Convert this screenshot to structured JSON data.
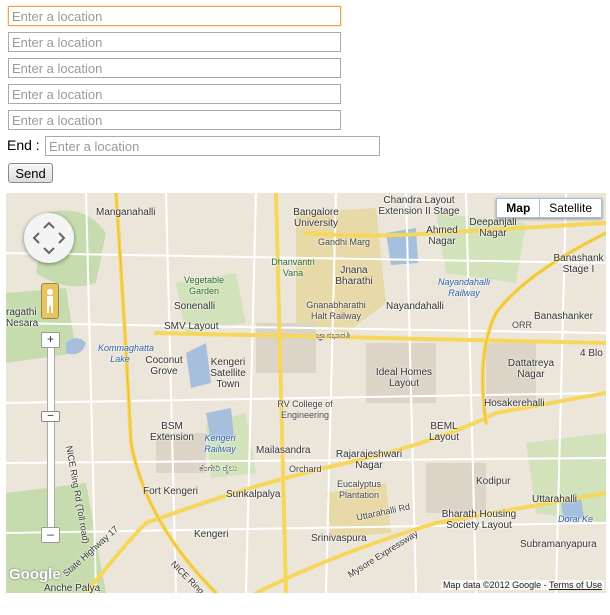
{
  "form": {
    "location_placeholder": "Enter a location",
    "end_label": "End :",
    "send_label": "Send"
  },
  "map": {
    "type_map": "Map",
    "type_satellite": "Satellite",
    "google": "Google",
    "attribution": "Map data ©2012 Google -",
    "terms": "Terms of Use",
    "labels": {
      "manganahalli": "Manganahalli",
      "bangalore_univ": "Bangalore University",
      "chandra_layout": "Chandra Layout Extension II Stage",
      "deepanjali": "Deepanjali Nagar",
      "ahmed": "Ahmed Nagar",
      "banashankari_3": "Banashank Stage I",
      "gandhi_marg": "Gandhi Marg",
      "dhanvantri": "Dhanvantri Vana",
      "jnana": "Jnana Bharathi",
      "nayandahalli_rly": "Nayandahalli Railway",
      "vegetable": "Vegetable Garden",
      "sonenalli": "Sonenalli",
      "gnana_halt": "Gnanabharathi Halt Railway",
      "gnana_kannada": "ಜ್ಞಾನಭಾರತಿ",
      "nayandahalli": "Nayandahalli",
      "banashankari": "Banashanker",
      "pragathi": "ragathi Nesara",
      "smv": "SMV Layout",
      "orr": "ORR",
      "kommaghatta": "Kommaghatta Lake",
      "coconut": "Coconut Grove",
      "ideal": "Ideal Homes Layout",
      "dattatreya": "Dattatreya Nagar",
      "four_block": "4 Blo",
      "kengeri_sat": "Kengeri Satellite Town",
      "rv_college": "RV College of Engineering",
      "hosakerehalli": "Hosakerehalli",
      "bsm": "BSM Extension",
      "kengeri_rly": "Kengeri Railway",
      "kengeri_rly_kn": "ಕೆಂಗೇರಿ ರೈಲು",
      "beml": "BEML Layout",
      "mailasandra": "Mailasandra",
      "rajarajeshwari": "Rajarajeshwari Nagar",
      "orchard": "Orchard",
      "nice_ring": "NICE Ring Rd (Toll road)",
      "eucalyptus": "Eucalyptus Plantation",
      "kodipur": "Kodipur",
      "fort_kengeri": "Fort Kengeri",
      "sunkalpalya": "Sunkalpalya",
      "uttarahalli": "Uttarahalli",
      "uttarahalli_rd": "Uttarahalli Rd",
      "bharath": "Bharath Housing Society Layout",
      "dorai": "Dorai Ke",
      "kengeri": "Kengeri",
      "srinivaspura": "Srinivaspura",
      "subramanyapura": "Subramanyapura",
      "state_hwy": "State Highway 17",
      "nice_ring2": "NICE Ring",
      "mysore_exp": "Mysore Expressway",
      "anche": "Anche Palya"
    }
  },
  "colors": {
    "focus_border": "#e6a84a",
    "map_bg": "#efe9de",
    "road_yellow": "#f6d75b",
    "water": "#a5bfdd",
    "park": "#c6dcae",
    "campus": "#e8d9a8"
  }
}
